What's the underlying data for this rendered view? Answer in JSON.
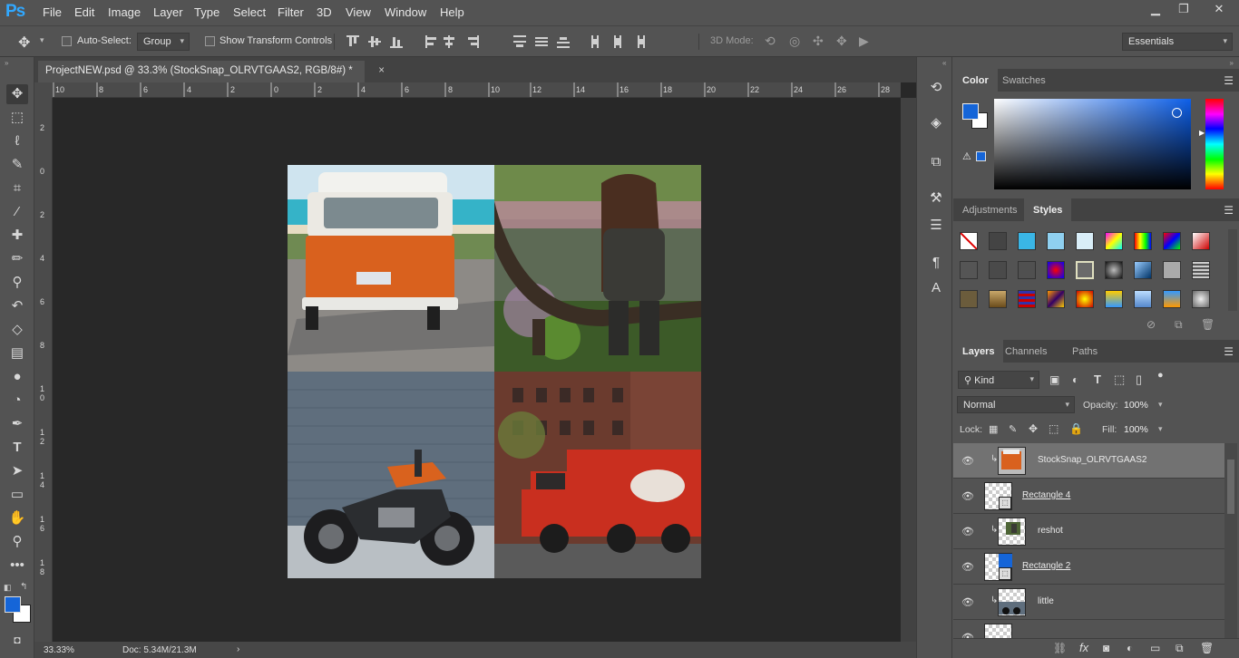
{
  "app": {
    "logo": "Ps"
  },
  "menu": [
    "File",
    "Edit",
    "Image",
    "Layer",
    "Type",
    "Select",
    "Filter",
    "3D",
    "View",
    "Window",
    "Help"
  ],
  "options": {
    "auto_select_label": "Auto-Select:",
    "auto_select_value": "Group",
    "show_transform_label": "Show Transform Controls",
    "mode_3d_label": "3D Mode:",
    "workspace": "Essentials"
  },
  "document": {
    "tab_title": "ProjectNEW.psd @ 33.3% (StockSnap_OLRVTGAAS2, RGB/8#) *",
    "close": "×",
    "zoom": "33.33%",
    "doc_info": "Doc: 5.34M/21.3M",
    "hruler": [
      "10",
      "8",
      "6",
      "4",
      "2",
      "0",
      "2",
      "4",
      "6",
      "8",
      "10",
      "12",
      "14",
      "16",
      "18",
      "20",
      "22",
      "24",
      "26",
      "28"
    ],
    "vruler": [
      "2",
      "0",
      "2",
      "4",
      "6",
      "8",
      "10",
      "12",
      "14",
      "16",
      "18"
    ]
  },
  "panels": {
    "color_tabs": [
      "Color",
      "Swatches"
    ],
    "colors": {
      "foreground": "#1565d8",
      "background": "#ffffff",
      "accent": "#1565d8"
    },
    "adjust_tabs": [
      "Adjustments",
      "Styles"
    ],
    "layers_tabs": [
      "Layers",
      "Channels",
      "Paths"
    ],
    "kind_label": "Kind",
    "blend_mode": "Normal",
    "opacity_label": "Opacity:",
    "opacity_value": "100%",
    "lock_label": "Lock:",
    "fill_label": "Fill:",
    "fill_value": "100%",
    "layers": [
      {
        "name": "StockSnap_OLRVTGAAS2",
        "selected": true,
        "clipped": true,
        "underline": false
      },
      {
        "name": "Rectangle 4",
        "selected": false,
        "clipped": false,
        "underline": true
      },
      {
        "name": "reshot",
        "selected": false,
        "clipped": true,
        "underline": false
      },
      {
        "name": "Rectangle 2",
        "selected": false,
        "clipped": false,
        "underline": true
      },
      {
        "name": "little",
        "selected": false,
        "clipped": true,
        "underline": false
      }
    ]
  }
}
